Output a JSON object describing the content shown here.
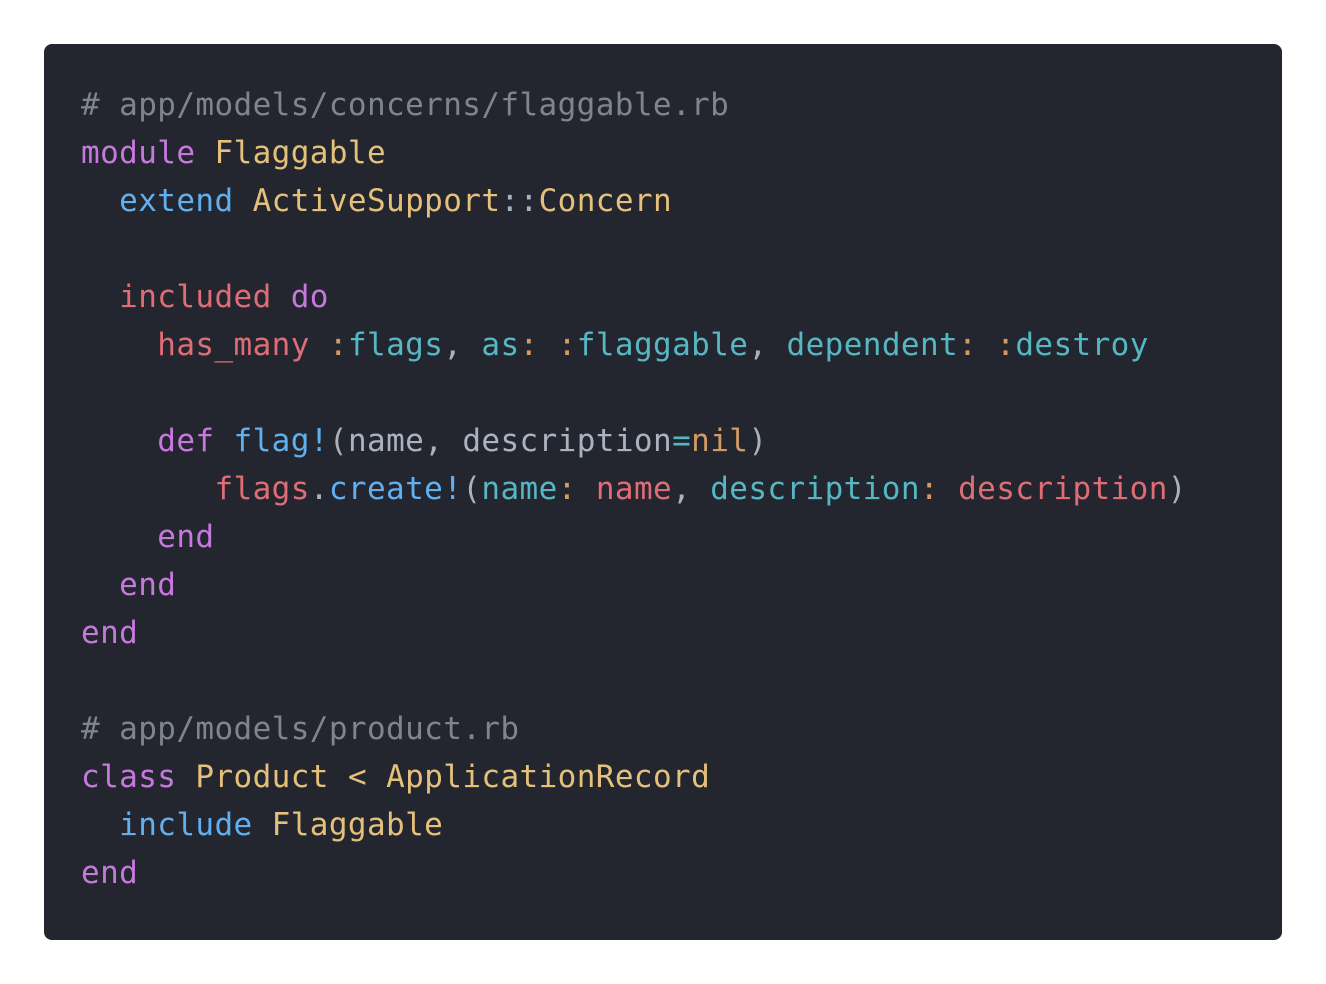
{
  "code_block": {
    "language": "ruby",
    "lines": [
      "# app/models/concerns/flaggable.rb",
      "module Flaggable",
      "  extend ActiveSupport::Concern",
      "",
      "  included do",
      "    has_many :flags, as: :flaggable, dependent: :destroy",
      "",
      "    def flag!(name, description=nil)",
      "      flags.create!(name: name, description: description)",
      "    end",
      "  end",
      "end",
      "",
      "# app/models/product.rb",
      "class Product < ApplicationRecord",
      "  include Flaggable",
      "end"
    ],
    "tokens": {
      "l0": {
        "comment": "# app/models/concerns/flaggable.rb"
      },
      "l1": {
        "kw": "module",
        "name": "Flaggable"
      },
      "l2": {
        "kw": "extend",
        "name": "ActiveSupport",
        "sep": "::",
        "name2": "Concern"
      },
      "l4": {
        "kw": "included",
        "kw2": "do"
      },
      "l5": {
        "fn": "has_many",
        "s1": "flags",
        "k1": "as",
        "s2": "flaggable",
        "k2": "dependent",
        "s3": "destroy"
      },
      "l7": {
        "kw": "def",
        "fn": "flag!",
        "p1": "name",
        "p2": "description",
        "op": "=",
        "nil": "nil"
      },
      "l8": {
        "recv": "flags",
        "fn": "create!",
        "k1": "name",
        "v1": "name",
        "k2": "description",
        "v2": "description"
      },
      "l9": {
        "kw": "end"
      },
      "l10": {
        "kw": "end"
      },
      "l11": {
        "kw": "end"
      },
      "l13": {
        "comment": "# app/models/product.rb"
      },
      "l14": {
        "kw": "class",
        "name": "Product",
        "op": "<",
        "parent": "ApplicationRecord"
      },
      "l15": {
        "kw": "include",
        "name": "Flaggable"
      },
      "l16": {
        "kw": "end"
      }
    }
  },
  "colors": {
    "background": "#23262f",
    "comment": "#7f848e",
    "keyword": "#c678dd",
    "constant": "#e5c07b",
    "function": "#61afef",
    "identifier_red": "#e06c75",
    "symbol": "#56b6c2",
    "symbol_colon": "#d19a66"
  }
}
